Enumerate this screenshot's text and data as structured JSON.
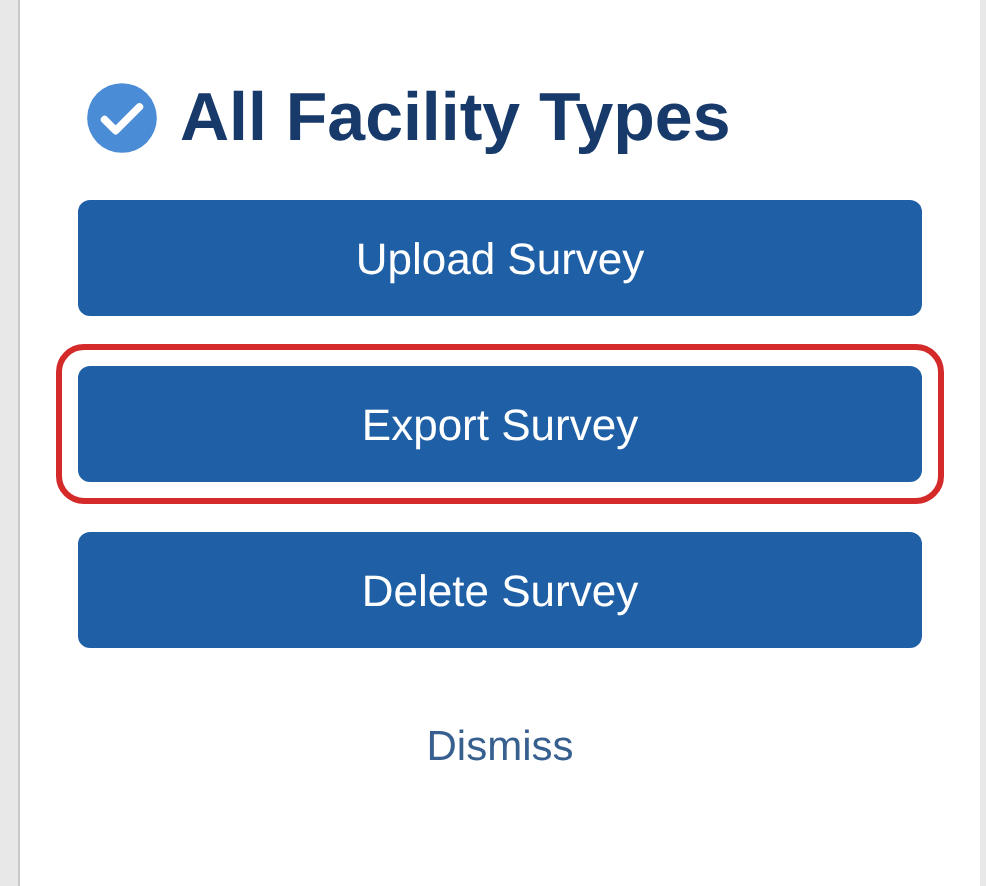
{
  "title": "All Facility Types",
  "buttons": [
    {
      "label": "Upload Survey",
      "highlighted": false
    },
    {
      "label": "Export Survey",
      "highlighted": true
    },
    {
      "label": "Delete Survey",
      "highlighted": false
    }
  ],
  "dismiss": "Dismiss"
}
